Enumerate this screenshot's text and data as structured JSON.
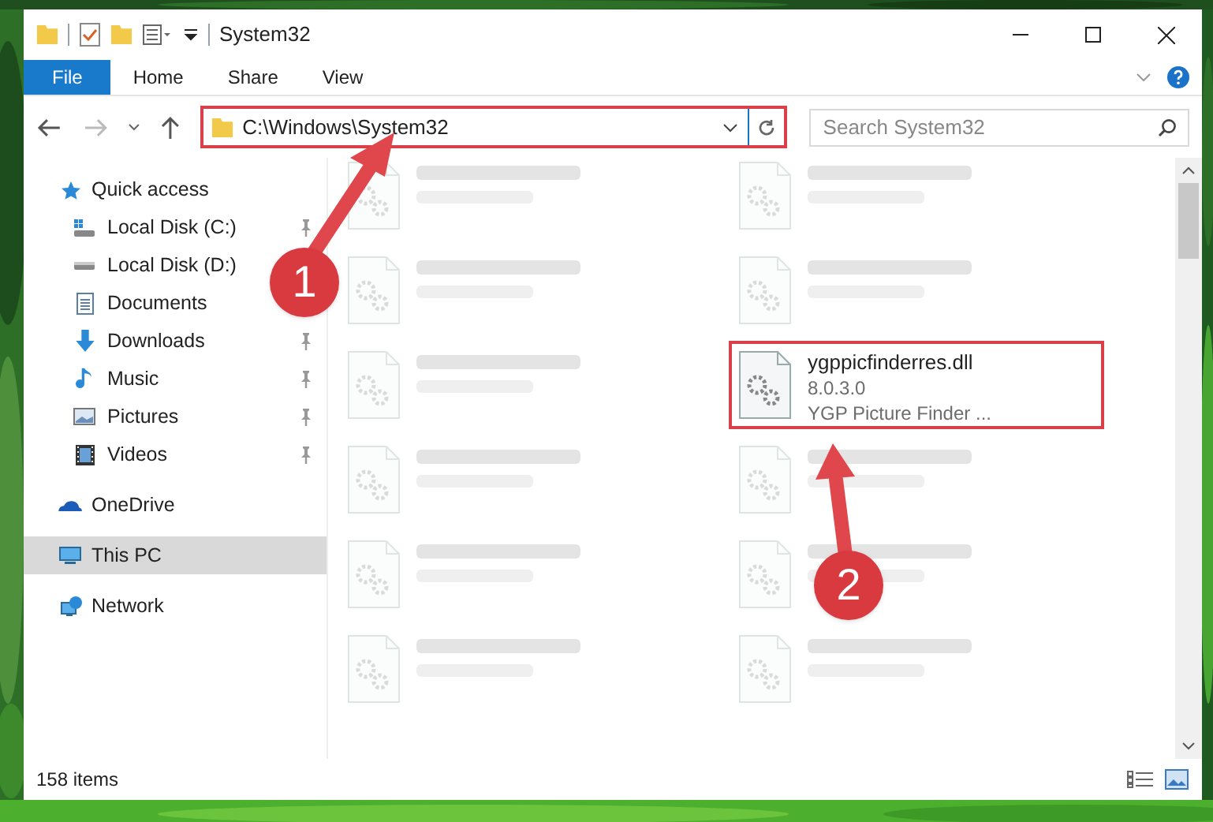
{
  "window": {
    "title": "System32"
  },
  "ribbon_tabs": [
    {
      "label": "File",
      "selected": true
    },
    {
      "label": "Home",
      "selected": false
    },
    {
      "label": "Share",
      "selected": false
    },
    {
      "label": "View",
      "selected": false
    }
  ],
  "address": {
    "path": "C:\\Windows\\System32",
    "highlighted": true
  },
  "search": {
    "placeholder": "Search System32"
  },
  "sidebar": {
    "items": [
      {
        "label": "Quick access",
        "kind": "star",
        "selected": false,
        "children": [
          {
            "label": "Local Disk (C:)",
            "kind": "system-drive",
            "pinned": true
          },
          {
            "label": "Local Disk (D:)",
            "kind": "drive",
            "pinned": false
          },
          {
            "label": "Documents",
            "kind": "documents",
            "pinned": false
          },
          {
            "label": "Downloads",
            "kind": "downloads",
            "pinned": true
          },
          {
            "label": "Music",
            "kind": "music",
            "pinned": true
          },
          {
            "label": "Pictures",
            "kind": "pictures",
            "pinned": true
          },
          {
            "label": "Videos",
            "kind": "videos",
            "pinned": true
          }
        ]
      },
      {
        "label": "OneDrive",
        "kind": "cloud",
        "selected": false
      },
      {
        "label": "This PC",
        "kind": "pc",
        "selected": true
      },
      {
        "label": "Network",
        "kind": "network",
        "selected": false
      }
    ]
  },
  "files": [
    {
      "kind": "blurred"
    },
    {
      "kind": "blurred"
    },
    {
      "kind": "blurred"
    },
    {
      "kind": "blurred"
    },
    {
      "kind": "blurred"
    },
    {
      "kind": "file",
      "name": "ygppicfinderres.dll",
      "details": [
        "8.0.3.0",
        "YGP Picture Finder ..."
      ],
      "highlighted": true
    },
    {
      "kind": "blurred"
    },
    {
      "kind": "blurred"
    },
    {
      "kind": "blurred"
    },
    {
      "kind": "blurred"
    },
    {
      "kind": "blurred"
    },
    {
      "kind": "blurred"
    }
  ],
  "status_bar": {
    "item_count": "158 items"
  },
  "annotations": [
    {
      "label": "1"
    },
    {
      "label": "2"
    }
  ]
}
